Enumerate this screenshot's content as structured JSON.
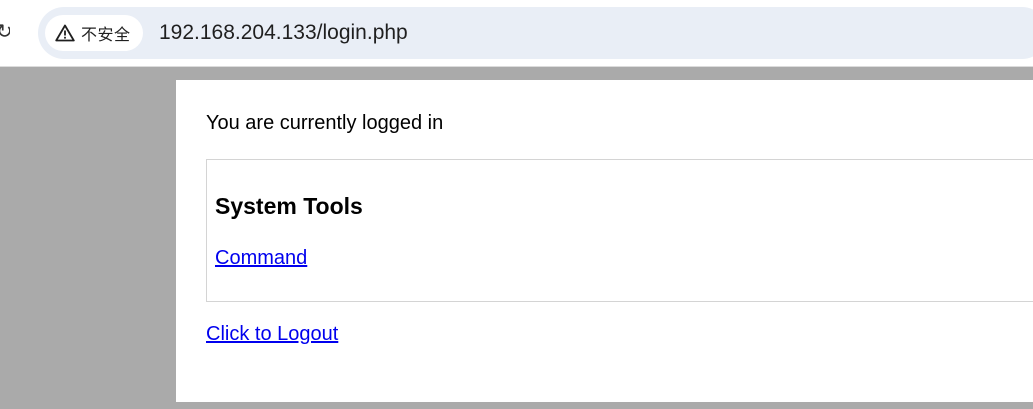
{
  "browser": {
    "security_label": "不安全",
    "security_icon": "warning-triangle-icon",
    "url": "192.168.204.133/login.php",
    "reload_icon": "reload-icon"
  },
  "page": {
    "status_text": "You are currently logged in",
    "tools": {
      "heading": "System Tools",
      "links": [
        {
          "label": "Command"
        }
      ]
    },
    "logout_label": "Click to Logout"
  },
  "colors": {
    "background": "#aaaaaa",
    "link": "#0000ee",
    "omnibox": "#e9eef6"
  }
}
